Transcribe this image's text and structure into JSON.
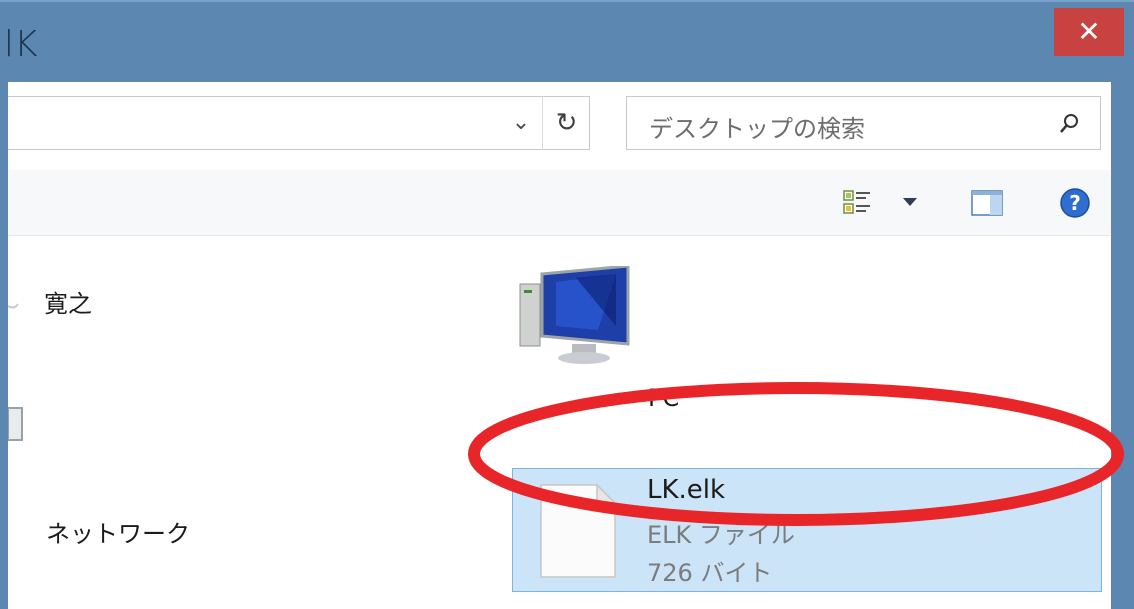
{
  "window": {
    "title_fragment": "lK",
    "close_glyph": "✕"
  },
  "address_bar": {
    "dropdown_glyph": "⌄",
    "refresh_glyph": "↻"
  },
  "search": {
    "placeholder": "デスクトップの検索"
  },
  "toolbar": {
    "icons": [
      "view-options-icon",
      "dropdown-arrow-icon",
      "preview-pane-icon",
      "help-icon"
    ]
  },
  "items": {
    "user": {
      "label": "寛之"
    },
    "pc": {
      "label": "PC"
    },
    "network": {
      "label": "ネットワーク"
    },
    "selected_file": {
      "name": "LK.elk",
      "type": "ELK ファイル",
      "size": "726 バイト"
    }
  },
  "colors": {
    "frame": "#5b87b1",
    "close": "#c84242",
    "selection": "#cce4f7",
    "annotation": "#e8262a"
  }
}
